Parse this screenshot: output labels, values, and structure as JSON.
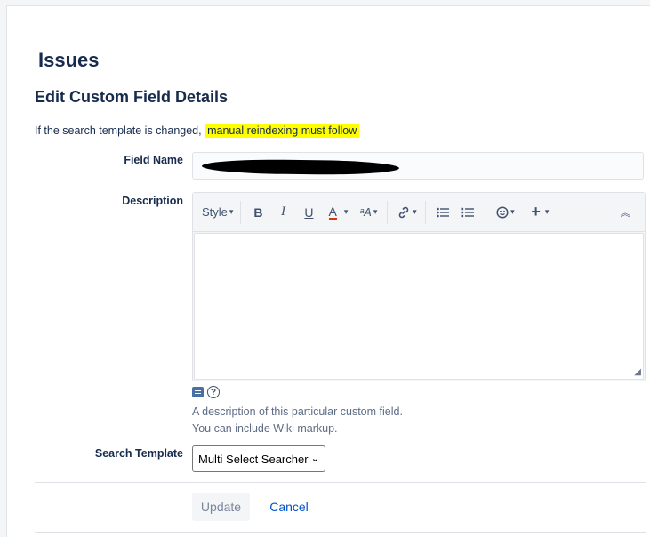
{
  "page": {
    "title": "Issues",
    "section_title": "Edit Custom Field Details",
    "warning_prefix": "If the search template is changed,",
    "warning_highlight": "manual reindexing must follow"
  },
  "form": {
    "field_name": {
      "label": "Field Name"
    },
    "description": {
      "label": "Description",
      "toolbar": {
        "style_label": "Style",
        "bold": "B",
        "italic": "I",
        "underline": "U",
        "text_color": "A",
        "font_size": "ᵃA"
      },
      "hint_line1": "A description of this particular custom field.",
      "hint_line2": "You can include Wiki markup."
    },
    "search_template": {
      "label": "Search Template",
      "selected": "Multi Select Searcher"
    }
  },
  "actions": {
    "update_label": "Update",
    "cancel_label": "Cancel"
  },
  "colors": {
    "highlight": "#ffff00",
    "link": "#0052cc",
    "text": "#172b4d"
  }
}
